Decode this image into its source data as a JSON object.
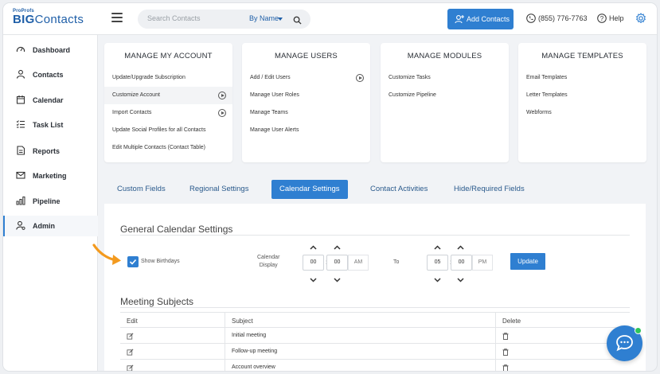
{
  "brand": {
    "top": "ProProfs",
    "name_bold": "BIG",
    "name_light": "Contacts",
    "color": "#1f5fa8"
  },
  "header": {
    "search_placeholder": "Search Contacts",
    "search_by": "By Name",
    "add_contacts": "Add Contacts",
    "phone": "(855) 776-7763",
    "help": "Help",
    "accent": "#2f7fd1"
  },
  "sidebar": {
    "items": [
      {
        "label": "Dashboard",
        "icon": "dashboard-icon"
      },
      {
        "label": "Contacts",
        "icon": "user-icon"
      },
      {
        "label": "Calendar",
        "icon": "calendar-icon"
      },
      {
        "label": "Task List",
        "icon": "task-list-icon"
      },
      {
        "label": "Reports",
        "icon": "reports-icon"
      },
      {
        "label": "Marketing",
        "icon": "mail-icon"
      },
      {
        "label": "Pipeline",
        "icon": "pipeline-icon"
      },
      {
        "label": "Admin",
        "icon": "admin-icon",
        "active": true
      }
    ]
  },
  "cards": [
    {
      "title": "MANAGE MY ACCOUNT",
      "rows": [
        "Update/Upgrade Subscription",
        "Customize Account",
        "Import Contacts",
        "Update Social Profiles for all Contacts",
        "Edit Multiple Contacts (Contact Table)"
      ]
    },
    {
      "title": "MANAGE USERS",
      "rows": [
        "Add / Edit Users",
        "Manage User Roles",
        "Manage Teams",
        "Manage User Alerts"
      ]
    },
    {
      "title": "MANAGE MODULES",
      "rows": [
        "Customize Tasks",
        "Customize Pipeline"
      ]
    },
    {
      "title": "MANAGE TEMPLATES",
      "rows": [
        "Email Templates",
        "Letter Templates",
        "Webforms"
      ]
    }
  ],
  "tabs": [
    "Custom Fields",
    "Regional Settings",
    "Calendar Settings",
    "Contact Activities",
    "Hide/Required Fields"
  ],
  "calendar": {
    "title": "General Calendar Settings",
    "show_birthdays": "Show Birthdays",
    "display_label_1": "Calendar",
    "display_label_2": "Display",
    "from_hour": "00",
    "from_min": "00",
    "from_ampm": "AM",
    "to_label": "To",
    "to_hour": "05",
    "to_min": "00",
    "to_ampm": "PM",
    "update": "Update"
  },
  "meeting": {
    "title": "Meeting Subjects",
    "headers": [
      "Edit",
      "Subject",
      "Delete"
    ],
    "rows": [
      "Initial meeting",
      "Follow-up meeting",
      "Account overview"
    ]
  }
}
